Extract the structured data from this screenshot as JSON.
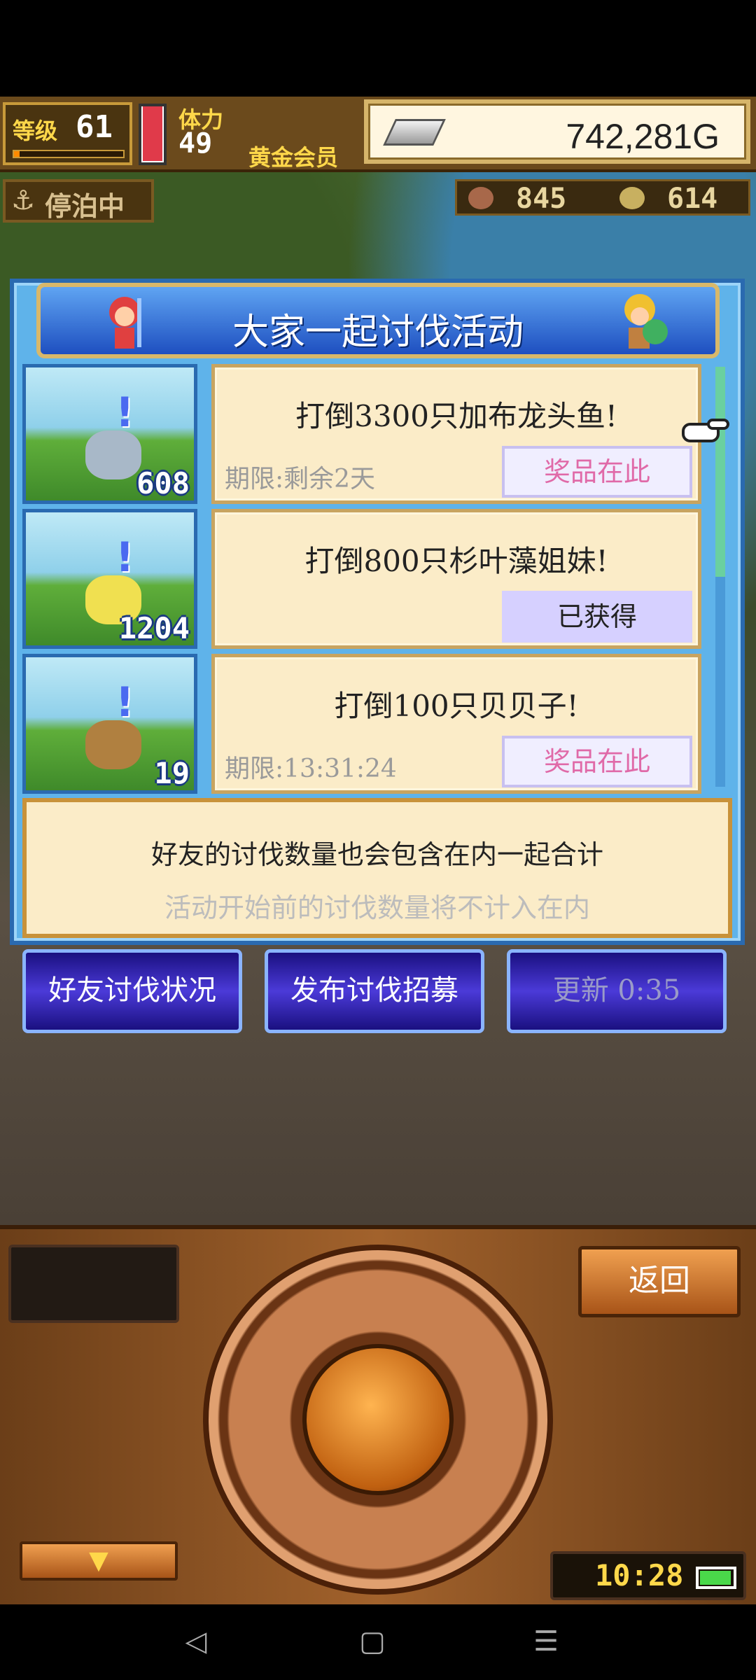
{
  "hud": {
    "level_label": "等级",
    "level": "61",
    "level_progress": 0.05,
    "stamina_label": "体力",
    "stamina": "49",
    "membership": "黄金会员",
    "gold": "742,281G",
    "dock_status": "停泊中",
    "resource_1": "845",
    "resource_2": "614"
  },
  "dialog": {
    "title": "大家一起讨伐活动",
    "quests": [
      {
        "title": "打倒3300只加布龙头鱼!",
        "deadline": "期限:剩余2天",
        "button": "奖品在此",
        "count": "608"
      },
      {
        "title": "打倒800只杉叶藻姐妹!",
        "deadline": "",
        "button": "已获得",
        "count": "1204"
      },
      {
        "title": "打倒100只贝贝子!",
        "deadline": "期限:13:31:24",
        "button": "奖品在此",
        "count": "19"
      }
    ],
    "info_main": "好友的讨伐数量也会包含在内一起合计",
    "info_sub": "活动开始前的讨伐数量将不计入在内"
  },
  "actions": {
    "friend_status": "好友讨伐状况",
    "post_recruit": "发布讨伐招募",
    "refresh": "更新 0:35"
  },
  "panel": {
    "back": "返回",
    "clock": "10:28"
  },
  "colors": {
    "dialog_bg": "#5fb3ea",
    "prize_text": "#e06aa8",
    "button_blue": "#4b3ad8"
  }
}
